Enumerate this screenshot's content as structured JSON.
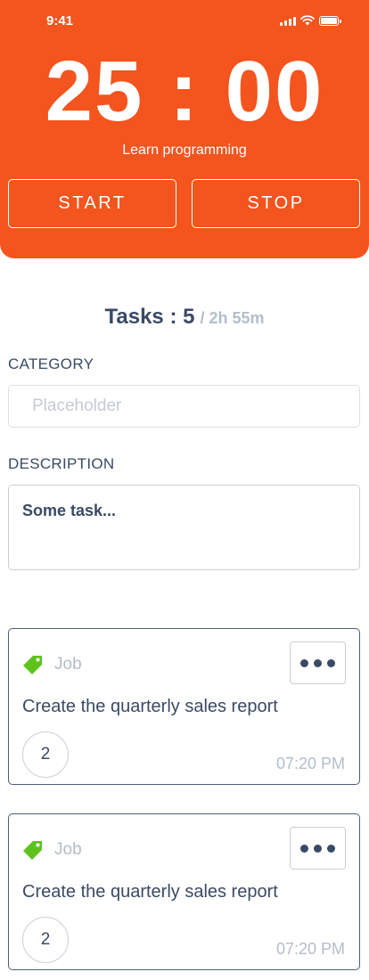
{
  "status_bar": {
    "time": "9:41"
  },
  "timer": {
    "display": "25 : 00",
    "label": "Learn programming",
    "start_label": "START",
    "stop_label": "STOP"
  },
  "tasks": {
    "title": "Tasks : 5",
    "duration": "/ 2h 55m"
  },
  "form": {
    "category_label": "CATEGORY",
    "category_placeholder": "Placeholder",
    "description_label": "DESCRIPTION",
    "description_value": "Some task..."
  },
  "cards": [
    {
      "category": "Job",
      "title": "Create the quarterly sales report",
      "count": "2",
      "time": "07:20 PM"
    },
    {
      "category": "Job",
      "title": "Create the quarterly sales report",
      "count": "2",
      "time": "07:20 PM"
    }
  ],
  "colors": {
    "accent": "#F4541E",
    "text_primary": "#3A4A66",
    "text_muted": "#B4BDCA",
    "tag_green": "#5DC31C"
  },
  "icons": [
    "signal-icon",
    "wifi-icon",
    "battery-icon",
    "tag-icon",
    "more-dots-icon"
  ]
}
